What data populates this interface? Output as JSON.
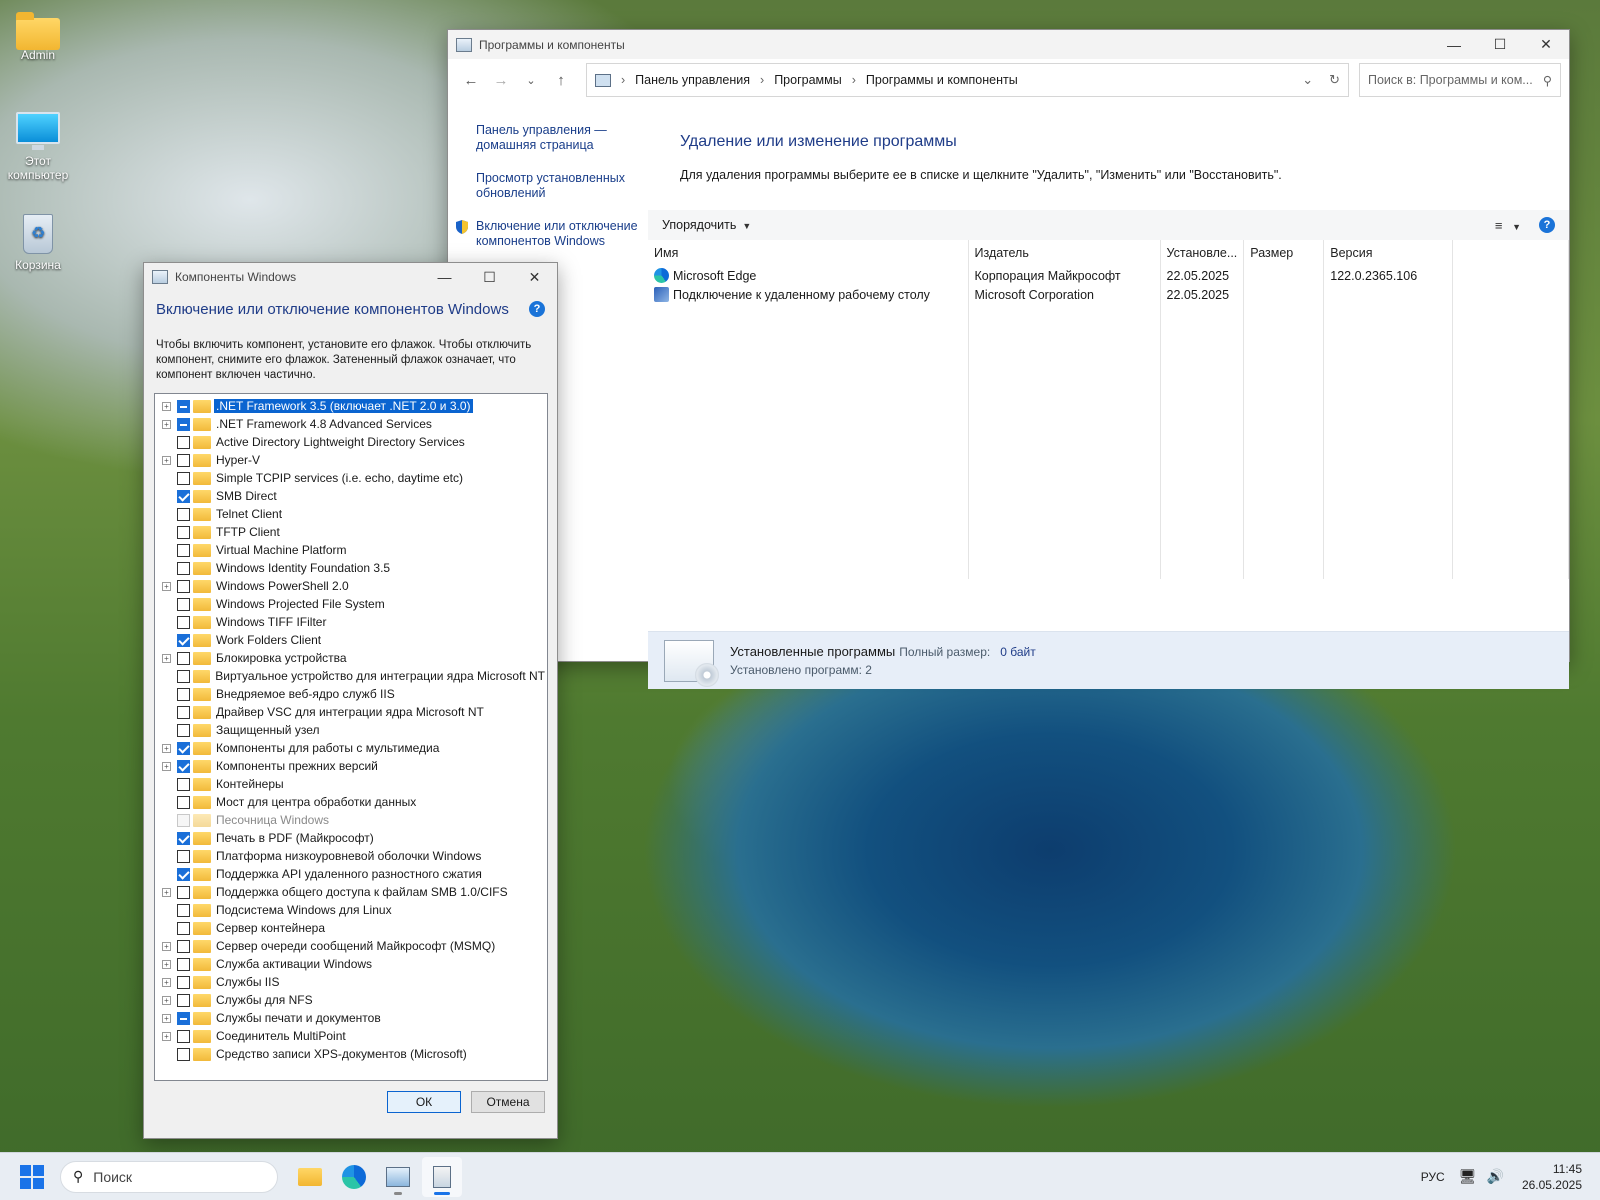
{
  "desktop": {
    "icons": [
      {
        "label": "Admin",
        "icon": "folder-icon"
      },
      {
        "label": "Этот компьютер",
        "icon": "computer-icon"
      },
      {
        "label": "Корзина",
        "icon": "recycle-bin-icon"
      }
    ]
  },
  "control_panel": {
    "title": "Программы и компоненты",
    "breadcrumb": [
      "Панель управления",
      "Программы",
      "Программы и компоненты"
    ],
    "search_placeholder": "Поиск в: Программы и ком...",
    "sidebar": {
      "home": "Панель управления — домашняя страница",
      "updates": "Просмотр установленных обновлений",
      "features": "Включение или отключение компонентов Windows"
    },
    "heading": "Удаление или изменение программы",
    "description": "Для удаления программы выберите ее в списке и щелкните \"Удалить\", \"Изменить\" или \"Восстановить\".",
    "toolbar": {
      "sort_label": "Упорядочить"
    },
    "columns": [
      "Имя",
      "Издатель",
      "Установле...",
      "Размер",
      "Версия"
    ],
    "programs": [
      {
        "name": "Microsoft Edge",
        "publisher": "Корпорация Майкрософт",
        "installed": "22.05.2025",
        "size": "",
        "version": "122.0.2365.106",
        "icon": "edge-icon"
      },
      {
        "name": "Подключение к удаленному рабочему столу",
        "publisher": "Microsoft Corporation",
        "installed": "22.05.2025",
        "size": "",
        "version": "",
        "icon": "remote-desktop-icon"
      }
    ],
    "status": {
      "label": "Установленные программы",
      "size_label": "Полный размер:",
      "size_value": "0 байт",
      "count_text": "Установлено программ: 2"
    }
  },
  "features_dialog": {
    "title": "Компоненты Windows",
    "heading": "Включение или отключение компонентов Windows",
    "description": "Чтобы включить компонент, установите его флажок. Чтобы отключить компонент, снимите его флажок. Затененный флажок означает, что компонент включен частично.",
    "features": [
      {
        "label": ".NET Framework 3.5 (включает .NET 2.0 и 3.0)",
        "state": "partial",
        "expandable": true,
        "selected": true
      },
      {
        "label": ".NET Framework 4.8 Advanced Services",
        "state": "partial",
        "expandable": true
      },
      {
        "label": "Active Directory Lightweight Directory Services",
        "state": "unchecked",
        "expandable": false
      },
      {
        "label": "Hyper-V",
        "state": "unchecked",
        "expandable": true
      },
      {
        "label": "Simple TCPIP services (i.e. echo, daytime etc)",
        "state": "unchecked",
        "expandable": false
      },
      {
        "label": "SMB Direct",
        "state": "checked",
        "expandable": false
      },
      {
        "label": "Telnet Client",
        "state": "unchecked",
        "expandable": false
      },
      {
        "label": "TFTP Client",
        "state": "unchecked",
        "expandable": false
      },
      {
        "label": "Virtual Machine Platform",
        "state": "unchecked",
        "expandable": false
      },
      {
        "label": "Windows Identity Foundation 3.5",
        "state": "unchecked",
        "expandable": false
      },
      {
        "label": "Windows PowerShell 2.0",
        "state": "unchecked",
        "expandable": true
      },
      {
        "label": "Windows Projected File System",
        "state": "unchecked",
        "expandable": false
      },
      {
        "label": "Windows TIFF IFilter",
        "state": "unchecked",
        "expandable": false
      },
      {
        "label": "Work Folders Client",
        "state": "checked",
        "expandable": false
      },
      {
        "label": "Блокировка устройства",
        "state": "unchecked",
        "expandable": true
      },
      {
        "label": "Виртуальное устройство для интеграции ядра Microsoft NT",
        "state": "unchecked",
        "expandable": false
      },
      {
        "label": "Внедряемое веб-ядро служб IIS",
        "state": "unchecked",
        "expandable": false
      },
      {
        "label": "Драйвер VSC для интеграции ядра Microsoft NT",
        "state": "unchecked",
        "expandable": false
      },
      {
        "label": "Защищенный узел",
        "state": "unchecked",
        "expandable": false
      },
      {
        "label": "Компоненты для работы с мультимедиа",
        "state": "checked",
        "expandable": true
      },
      {
        "label": "Компоненты прежних версий",
        "state": "checked",
        "expandable": true
      },
      {
        "label": "Контейнеры",
        "state": "unchecked",
        "expandable": false
      },
      {
        "label": "Мост для центра обработки данных",
        "state": "unchecked",
        "expandable": false
      },
      {
        "label": "Песочница Windows",
        "state": "disabled",
        "expandable": false
      },
      {
        "label": "Печать в PDF (Майкрософт)",
        "state": "checked",
        "expandable": false
      },
      {
        "label": "Платформа низкоуровневой оболочки Windows",
        "state": "unchecked",
        "expandable": false
      },
      {
        "label": "Поддержка API удаленного разностного сжатия",
        "state": "checked",
        "expandable": false
      },
      {
        "label": "Поддержка общего доступа к файлам SMB 1.0/CIFS",
        "state": "unchecked",
        "expandable": true
      },
      {
        "label": "Подсистема Windows для Linux",
        "state": "unchecked",
        "expandable": false
      },
      {
        "label": "Сервер контейнера",
        "state": "unchecked",
        "expandable": false
      },
      {
        "label": "Сервер очереди сообщений Майкрософт (MSMQ)",
        "state": "unchecked",
        "expandable": true
      },
      {
        "label": "Служба активации Windows",
        "state": "unchecked",
        "expandable": true
      },
      {
        "label": "Службы IIS",
        "state": "unchecked",
        "expandable": true
      },
      {
        "label": "Службы для NFS",
        "state": "unchecked",
        "expandable": true
      },
      {
        "label": "Службы печати и документов",
        "state": "partial",
        "expandable": true
      },
      {
        "label": "Соединитель MultiPoint",
        "state": "unchecked",
        "expandable": true
      },
      {
        "label": "Средство записи XPS-документов (Microsoft)",
        "state": "unchecked",
        "expandable": false
      }
    ],
    "ok_label": "ОК",
    "cancel_label": "Отмена"
  },
  "taskbar": {
    "search_placeholder": "Поиск",
    "apps": [
      "file-explorer-icon",
      "edge-icon",
      "control-panel-icon",
      "windows-features-icon"
    ],
    "language": "РУС",
    "time": "11:45",
    "date": "26.05.2025"
  }
}
